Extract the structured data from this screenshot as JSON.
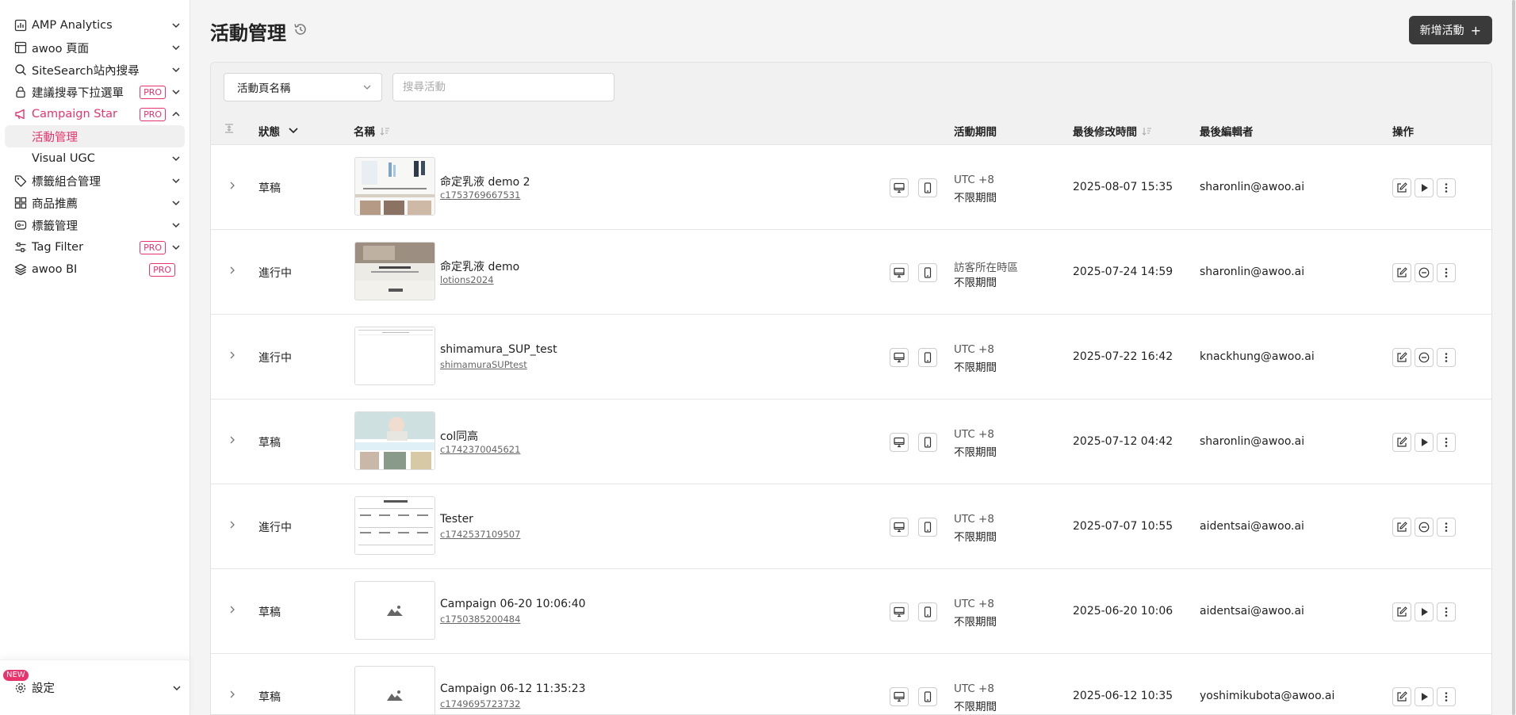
{
  "sidebar": {
    "items": [
      {
        "label": "AMP Analytics",
        "icon": "bar-chart-icon",
        "pro": false,
        "chevron": "down"
      },
      {
        "label": "awoo 頁面",
        "icon": "layout-icon",
        "pro": false,
        "chevron": "down"
      },
      {
        "label": "SiteSearch站內搜尋",
        "icon": "search-icon",
        "pro": false,
        "chevron": "down"
      },
      {
        "label": "建議搜尋下拉選單",
        "icon": "lock-icon",
        "pro": true,
        "chevron": "down"
      },
      {
        "label": "Campaign Star",
        "icon": "megaphone-icon",
        "pro": true,
        "chevron": "up",
        "active": true
      },
      {
        "label": "標籤組合管理",
        "icon": "tags-icon",
        "pro": false,
        "chevron": "down"
      },
      {
        "label": "商品推薦",
        "icon": "grid-icon",
        "pro": false,
        "chevron": "down"
      },
      {
        "label": "標籤管理",
        "icon": "tag-manage-icon",
        "pro": false,
        "chevron": "down"
      },
      {
        "label": "Tag Filter",
        "icon": "sliders-icon",
        "pro": true,
        "chevron": "down"
      },
      {
        "label": "awoo BI",
        "icon": "layers-icon",
        "pro": true,
        "chevron": ""
      }
    ],
    "sub_items": [
      {
        "label": "活動管理",
        "selected": true
      },
      {
        "label": "Visual UGC",
        "selected": false
      }
    ],
    "pro_label": "PRO",
    "settings_label": "設定",
    "new_badge": "NEW"
  },
  "header": {
    "title": "活動管理",
    "add_button": "新增活動",
    "add_symbol": "+"
  },
  "filters": {
    "select_value": "活動頁名稱",
    "search_placeholder": "搜尋活動"
  },
  "table": {
    "columns": {
      "status": "狀態",
      "name": "名稱",
      "period": "活動期間",
      "modified": "最後修改時間",
      "editor": "最後編輯者",
      "actions": "操作"
    },
    "rows": [
      {
        "status": "草稿",
        "name": "命定乳液 demo 2",
        "code": "c1753769667531",
        "tz": "UTC +8",
        "period": "不限期間",
        "modified": "2025-08-07 15:35",
        "editor": "sharonlin@awoo.ai",
        "action": "play",
        "thumb": "cosmetic-page"
      },
      {
        "status": "進行中",
        "name": "命定乳液 demo",
        "code": "lotions2024",
        "tz": "訪客所在時區",
        "period": "不限期間",
        "modified": "2025-07-24 14:59",
        "editor": "sharonlin@awoo.ai",
        "action": "pause",
        "thumb": "lotion-page"
      },
      {
        "status": "進行中",
        "name": "shimamura_SUP_test",
        "code": "shimamuraSUPtest",
        "tz": "UTC +8",
        "period": "不限期間",
        "modified": "2025-07-22 16:42",
        "editor": "knackhung@awoo.ai",
        "action": "pause",
        "thumb": "blank-page"
      },
      {
        "status": "草稿",
        "name": "col同高",
        "code": "c1742370045621",
        "tz": "UTC +8",
        "period": "不限期間",
        "modified": "2025-07-12 04:42",
        "editor": "sharonlin@awoo.ai",
        "action": "play",
        "thumb": "model-page"
      },
      {
        "status": "進行中",
        "name": "Tester",
        "code": "c1742537109507",
        "tz": "UTC +8",
        "period": "不限期間",
        "modified": "2025-07-07 10:55",
        "editor": "aidentsai@awoo.ai",
        "action": "pause",
        "thumb": "list-page"
      },
      {
        "status": "草稿",
        "name": "Campaign 06-20 10:06:40",
        "code": "c1750385200484",
        "tz": "UTC +8",
        "period": "不限期間",
        "modified": "2025-06-20 10:06",
        "editor": "aidentsai@awoo.ai",
        "action": "play",
        "thumb": "placeholder"
      },
      {
        "status": "草稿",
        "name": "Campaign 06-12 11:35:23",
        "code": "c1749695723732",
        "tz": "UTC +8",
        "period": "不限期間",
        "modified": "2025-06-12 10:35",
        "editor": "yoshimikubota@awoo.ai",
        "action": "play",
        "thumb": "placeholder"
      }
    ]
  },
  "colors": {
    "accent": "#e8336d",
    "button_dark": "#3a3a3a"
  }
}
